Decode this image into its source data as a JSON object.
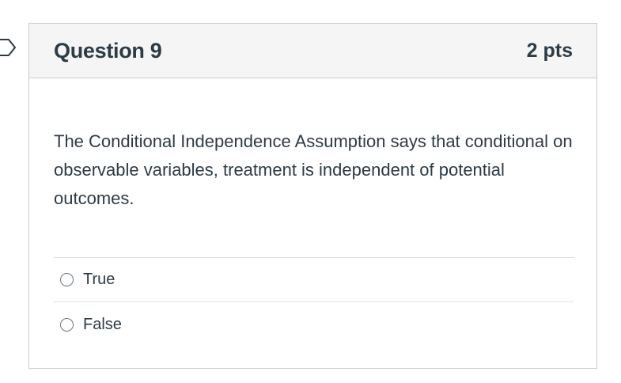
{
  "question": {
    "title": "Question 9",
    "points": "2 pts",
    "text": "The Conditional Independence Assumption says that conditional on observable variables, treatment is independent of potential outcomes.",
    "answers": [
      {
        "label": "True",
        "selected": false
      },
      {
        "label": "False",
        "selected": false
      }
    ]
  },
  "icons": {
    "flag": "flag-question-icon",
    "radio": "radio-button-icon"
  }
}
